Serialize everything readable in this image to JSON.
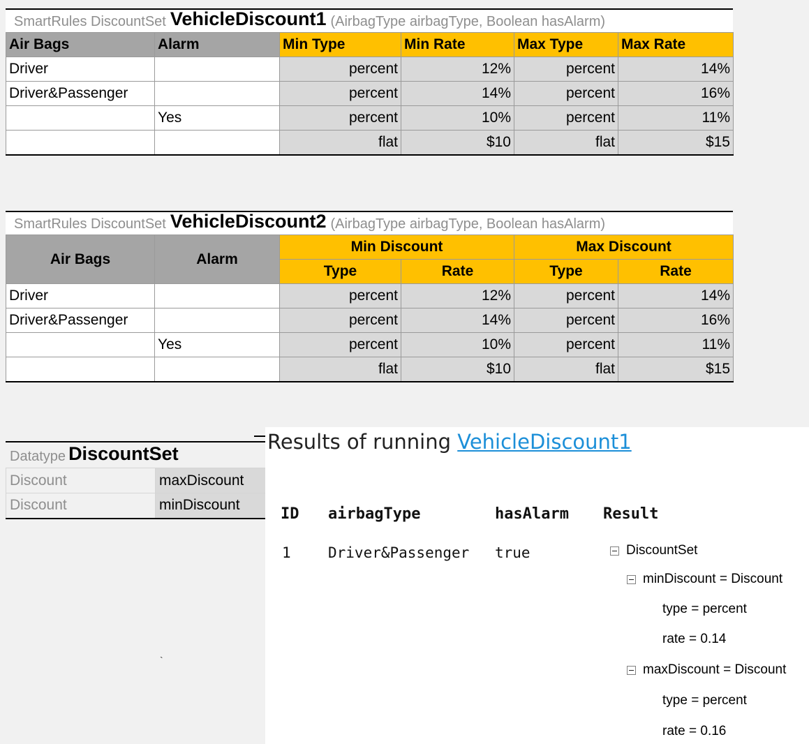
{
  "table1": {
    "prefix": "SmartRules DiscountSet",
    "name": "VehicleDiscount1",
    "args": "(AirbagType airbagType, Boolean hasAlarm)",
    "headers": [
      "Air Bags",
      "Alarm",
      "Min Type",
      "Min Rate",
      "Max Type",
      "Max Rate"
    ],
    "rows": [
      [
        "Driver",
        "",
        "percent",
        "12%",
        "percent",
        "14%"
      ],
      [
        "Driver&Passenger",
        "",
        "percent",
        "14%",
        "percent",
        "16%"
      ],
      [
        "",
        "Yes",
        "percent",
        "10%",
        "percent",
        "11%"
      ],
      [
        "",
        "",
        "flat",
        "$10",
        "flat",
        "$15"
      ]
    ]
  },
  "table2": {
    "prefix": "SmartRules DiscountSet",
    "name": "VehicleDiscount2",
    "args": "(AirbagType airbagType, Boolean hasAlarm)",
    "headers": {
      "air_bags": "Air Bags",
      "alarm": "Alarm",
      "min_discount": "Min Discount",
      "max_discount": "Max Discount",
      "min_type": "Type",
      "min_rate": "Rate",
      "max_type": "Type",
      "max_rate": "Rate"
    },
    "rows": [
      [
        "Driver",
        "",
        "percent",
        "12%",
        "percent",
        "14%"
      ],
      [
        "Driver&Passenger",
        "",
        "percent",
        "14%",
        "percent",
        "16%"
      ],
      [
        "",
        "Yes",
        "percent",
        "10%",
        "percent",
        "11%"
      ],
      [
        "",
        "",
        "flat",
        "$10",
        "flat",
        "$15"
      ]
    ]
  },
  "datatype": {
    "prefix": "Datatype",
    "name": "DiscountSet",
    "fields": [
      {
        "type": "Discount",
        "name": "maxDiscount"
      },
      {
        "type": "Discount",
        "name": "minDiscount"
      }
    ]
  },
  "results": {
    "title_prefix": "Results of running",
    "title_link": "VehicleDiscount1",
    "headers": {
      "id": "ID",
      "airbag": "airbagType",
      "alarm": "hasAlarm",
      "result": "Result"
    },
    "row": {
      "id": "1",
      "airbag": "Driver&Passenger",
      "alarm": "true"
    },
    "tree": {
      "root": "DiscountSet",
      "min": "minDiscount = Discount",
      "min_type": "type = percent",
      "min_rate": "rate = 0.14",
      "max": "maxDiscount = Discount",
      "max_type": "type = percent",
      "max_rate": "rate = 0.16"
    }
  },
  "colors": {
    "header_gold": "#ffc000",
    "header_gray": "#a5a5a5",
    "action_cell": "#d9d9d9",
    "link": "#1c8fd8"
  },
  "icons": [
    "collapse-icon"
  ],
  "stray_mark": "`"
}
